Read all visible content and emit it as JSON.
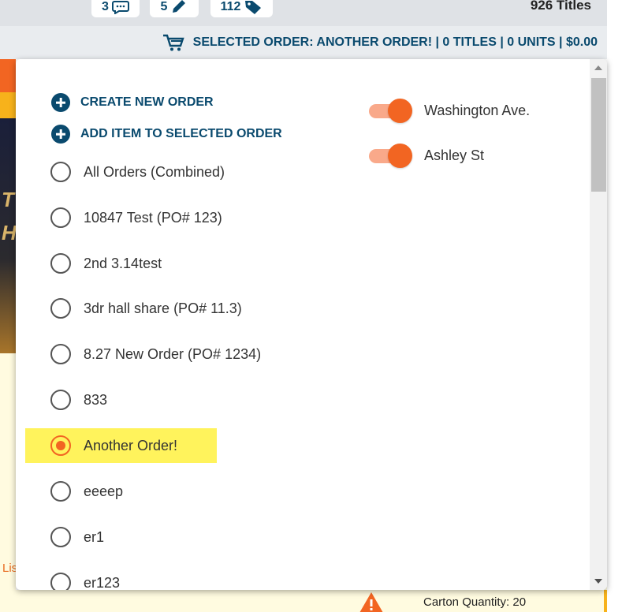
{
  "header": {
    "comments_count": "3",
    "edits_count": "5",
    "tags_count": "112",
    "titles_count": "926 Titles"
  },
  "selected_order_bar": {
    "text": "SELECTED ORDER: ANOTHER ORDER! | 0 TITLES | 0 UNITS | $0.00",
    "icon": "cart-icon"
  },
  "background": {
    "list_fragment": "Lis",
    "dark_text_1": "T",
    "dark_text_2": "H",
    "carton_quantity": "Carton Quantity: 20"
  },
  "dropdown": {
    "actions": [
      {
        "label": "CREATE NEW ORDER",
        "icon": "plus-circle-icon"
      },
      {
        "label": "ADD ITEM TO SELECTED ORDER",
        "icon": "plus-circle-icon"
      }
    ],
    "orders": [
      {
        "label": "All Orders (Combined)",
        "selected": false
      },
      {
        "label": "10847 Test (PO# 123)",
        "selected": false
      },
      {
        "label": "2nd 3.14test",
        "selected": false
      },
      {
        "label": "3dr hall share (PO# 11.3)",
        "selected": false
      },
      {
        "label": "8.27 New Order (PO# 1234)",
        "selected": false
      },
      {
        "label": "833",
        "selected": false
      },
      {
        "label": "Another Order!",
        "selected": true
      },
      {
        "label": "eeeep",
        "selected": false
      },
      {
        "label": "er1",
        "selected": false
      },
      {
        "label": "er123",
        "selected": false
      }
    ],
    "stores": [
      {
        "label": "Washington Ave.",
        "enabled": true
      },
      {
        "label": "Ashley St",
        "enabled": true
      }
    ]
  },
  "colors": {
    "accent": "#f26522",
    "brand_navy": "#0a4a6e",
    "highlight": "#fff35c"
  }
}
